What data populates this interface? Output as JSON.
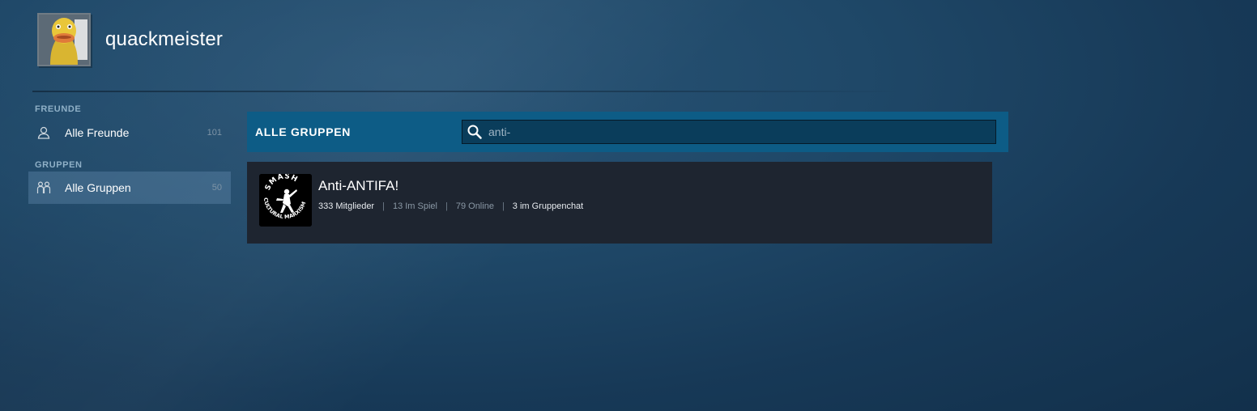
{
  "profile": {
    "username": "quackmeister",
    "avatar_icon": "duck-avatar"
  },
  "sidebar": {
    "friends_section": "FREUNDE",
    "groups_section": "GRUPPEN",
    "items": [
      {
        "label": "Alle Freunde",
        "count": "101",
        "icon": "person-icon",
        "active": false
      },
      {
        "label": "Alle Gruppen",
        "count": "50",
        "icon": "group-icon",
        "active": true
      }
    ]
  },
  "groups_panel": {
    "title": "ALLE GRUPPEN",
    "search": {
      "value": "anti-",
      "placeholder": ""
    }
  },
  "results": [
    {
      "name": "Anti-ANTIFA!",
      "logo_text_top": "SMASH",
      "logo_text_bottom": "CULTURAL MARXISM",
      "members": "333 Mitglieder",
      "in_game": "13 Im Spiel",
      "online": "79 Online",
      "in_chat": "3 im Gruppenchat"
    }
  ],
  "colors": {
    "header_bar": "#0d5c86",
    "card_bg": "#1e2530",
    "active_item": "#4f7696"
  }
}
